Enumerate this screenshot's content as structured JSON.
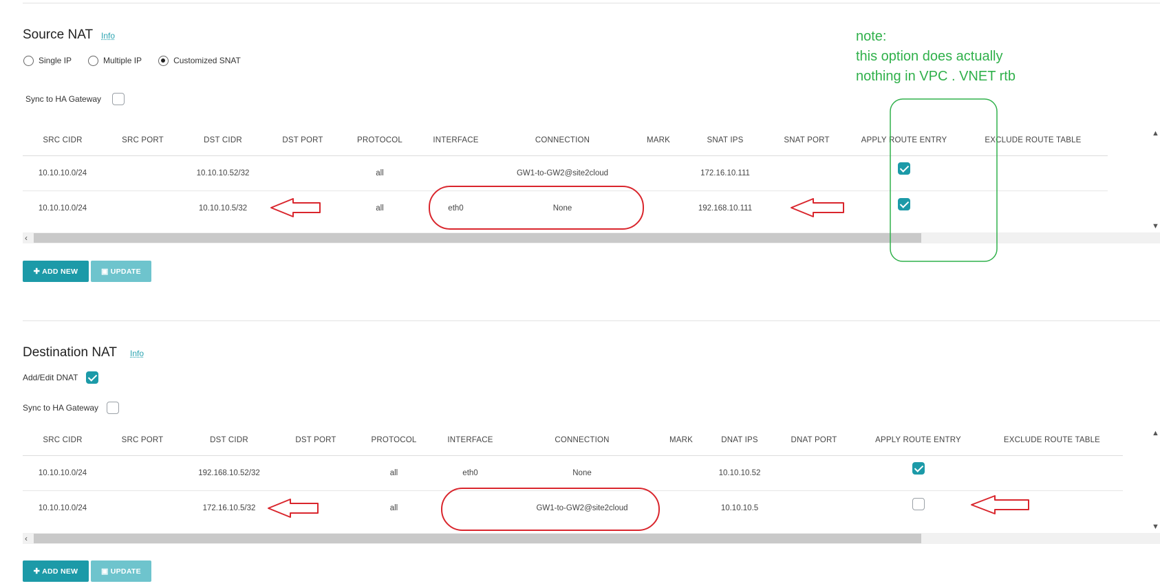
{
  "source_nat": {
    "title": "Source NAT",
    "info": "Info",
    "radios": [
      {
        "label": "Single IP",
        "selected": false
      },
      {
        "label": "Multiple IP",
        "selected": false
      },
      {
        "label": "Customized SNAT",
        "selected": true
      }
    ],
    "sync_label": "Sync to HA Gateway",
    "sync_checked": false,
    "columns": [
      "SRC CIDR",
      "SRC PORT",
      "DST CIDR",
      "DST PORT",
      "PROTOCOL",
      "INTERFACE",
      "CONNECTION",
      "MARK",
      "SNAT IPS",
      "SNAT PORT",
      "APPLY ROUTE ENTRY",
      "EXCLUDE ROUTE TABLE"
    ],
    "rows": [
      {
        "src_cidr": "10.10.10.0/24",
        "src_port": "",
        "dst_cidr": "10.10.10.52/32",
        "dst_port": "",
        "protocol": "all",
        "interface": "",
        "connection": "GW1-to-GW2@site2cloud",
        "mark": "",
        "ips": "172.16.10.111",
        "port": "",
        "apply_route": true,
        "exclude_route": ""
      },
      {
        "src_cidr": "10.10.10.0/24",
        "src_port": "",
        "dst_cidr": "10.10.10.5/32",
        "dst_port": "",
        "protocol": "all",
        "interface": "eth0",
        "connection": "None",
        "mark": "",
        "ips": "192.168.10.111",
        "port": "",
        "apply_route": true,
        "exclude_route": ""
      }
    ],
    "add_label": "ADD NEW",
    "update_label": "UPDATE"
  },
  "destination_nat": {
    "title": "Destination NAT",
    "info": "Info",
    "add_edit_label": "Add/Edit DNAT",
    "add_edit_checked": true,
    "sync_label": "Sync to HA Gateway",
    "sync_checked": false,
    "columns": [
      "SRC CIDR",
      "SRC PORT",
      "DST CIDR",
      "DST PORT",
      "PROTOCOL",
      "INTERFACE",
      "CONNECTION",
      "MARK",
      "DNAT IPS",
      "DNAT PORT",
      "APPLY ROUTE ENTRY",
      "EXCLUDE ROUTE TABLE"
    ],
    "rows": [
      {
        "src_cidr": "10.10.10.0/24",
        "src_port": "",
        "dst_cidr": "192.168.10.52/32",
        "dst_port": "",
        "protocol": "all",
        "interface": "eth0",
        "connection": "None",
        "mark": "",
        "ips": "10.10.10.52",
        "port": "",
        "apply_route": true,
        "exclude_route": ""
      },
      {
        "src_cidr": "10.10.10.0/24",
        "src_port": "",
        "dst_cidr": "172.16.10.5/32",
        "dst_port": "",
        "protocol": "all",
        "interface": "",
        "connection": "GW1-to-GW2@site2cloud",
        "mark": "",
        "ips": "10.10.10.5",
        "port": "",
        "apply_route": false,
        "exclude_route": ""
      }
    ],
    "add_label": "ADD NEW",
    "update_label": "UPDATE"
  },
  "note": {
    "line1": "note:",
    "line2": "this option does actually",
    "line3": "nothing in VPC . VNET rtb"
  },
  "colors": {
    "accent": "#1c9aa8",
    "accent_light": "#6ec4cd",
    "annotation_red": "#d9252c",
    "annotation_green": "#2fb04a"
  }
}
